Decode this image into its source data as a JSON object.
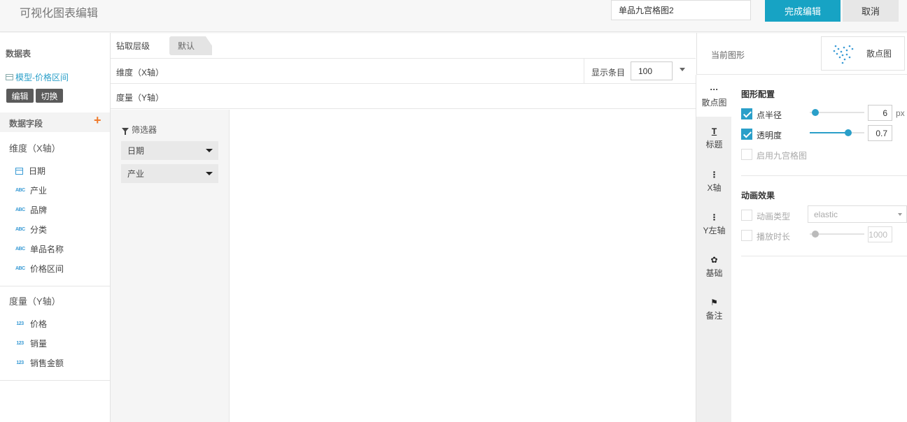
{
  "header": {
    "title": "可视化图表编辑",
    "chart_name_value": "单品九宫格图2",
    "done_label": "完成编辑",
    "cancel_label": "取消"
  },
  "left": {
    "dataset_title": "数据表",
    "dataset_name": "模型-价格区间",
    "edit_label": "编辑",
    "switch_label": "切换",
    "fields_title": "数据字段",
    "dimension_title": "维度（X轴）",
    "dimension_fields": [
      {
        "name": "日期",
        "icon": "calendar-icon"
      },
      {
        "name": "产业",
        "icon": "ABC"
      },
      {
        "name": "品牌",
        "icon": "ABC"
      },
      {
        "name": "分类",
        "icon": "ABC"
      },
      {
        "name": "单品名称",
        "icon": "ABC"
      },
      {
        "name": "价格区间",
        "icon": "ABC"
      }
    ],
    "measure_title": "度量（Y轴）",
    "measure_fields": [
      {
        "name": "价格",
        "icon": "123"
      },
      {
        "name": "销量",
        "icon": "123"
      },
      {
        "name": "销售金额",
        "icon": "123"
      }
    ]
  },
  "center": {
    "drill_label": "钻取层级",
    "drill_tab": "默认",
    "x_axis_label": "维度（X轴）",
    "y_axis_label": "度量（Y轴）",
    "count_label": "显示条目",
    "count_value": "100",
    "filter_title": "筛选器",
    "filters": [
      "日期",
      "产业"
    ]
  },
  "right": {
    "current_chart_label": "当前图形",
    "current_chart_name": "散点图",
    "tabs": [
      "散点图",
      "标题",
      "X轴",
      "Y左轴",
      "基础",
      "备注"
    ],
    "shape_config_title": "图形配置",
    "point_radius_label": "点半径",
    "point_radius_value": "6",
    "point_radius_unit": "px",
    "opacity_label": "透明度",
    "opacity_value": "0.7",
    "enable_grid_label": "启用九宫格图",
    "animation_title": "动画效果",
    "animation_type_label": "动画类型",
    "animation_type_value": "elastic",
    "play_duration_label": "播放时长",
    "play_duration_value": "1000"
  },
  "colors": {
    "accent": "#17a3c4",
    "link": "#2a9fc9",
    "plus": "#f07a2a"
  }
}
